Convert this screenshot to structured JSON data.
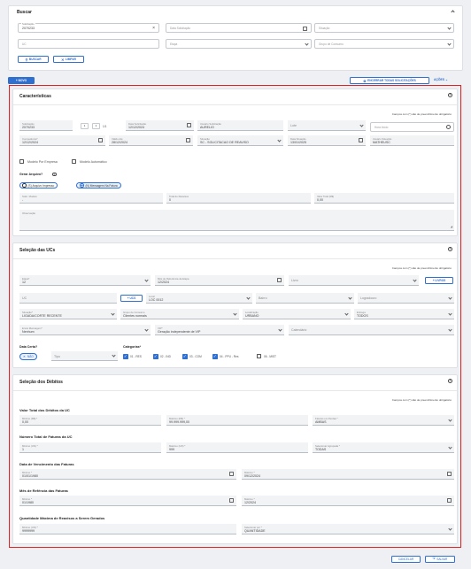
{
  "search": {
    "title": "Buscar",
    "solicitacao_label": "Solicitação",
    "solicitacao_value": "2070233",
    "data_solicitacao": "Data Solicitação",
    "situacao": "Situação",
    "uc": "UC",
    "etapa": "Etapa",
    "grupo_consumo": "Grupo de Consumo",
    "buscar": "BUSCAR",
    "limpar": "LIMPAR"
  },
  "toolbar": {
    "novo": "+ NOVO",
    "encerrar": "ENCERRAR TODAS SOLICITAÇÕES",
    "acoes": "AÇÕES"
  },
  "caracteristicas": {
    "title": "Características",
    "required_note": "Campos com (*) são de preenchimento obrigatório",
    "solicitacao_label": "Solicitação",
    "solicitacao_value": "2070233",
    "page_a": "1",
    "page_b": "1",
    "page_total": "1/1",
    "data_sol_label": "Data Solicitação",
    "data_sol_value": "12/12/2024",
    "usuario_sol_label": "Usuário Solicitação",
    "usuario_sol_value": "AURELIO",
    "lote": "Lote",
    "hora_inicio": "Hora Início",
    "competencia_label": "Competência*",
    "competencia_value": "12/12/2024",
    "valido_ate_label": "Válido Até",
    "valido_ate_value": "28/12/2024",
    "situacao_label": "Situação",
    "situacao_value": "SC - SOLICITACAO DE REAVISO",
    "data_situacao_label": "Data Situação",
    "data_situacao_value": "13/01/2025",
    "usuario_situacao_label": "Usuário Situação",
    "usuario_situacao_value": "MATHEUSC",
    "modelo_empresa": "Modelo Por Empresa",
    "modelo_automatico": "Modelo Automático",
    "gerar_arquivo": "Gerar Arquivo?",
    "radio_s": "(S) Arquivo Impresso",
    "radio_n": "(N) Mensagem Na Fatura",
    "solic_modelo_label": "Solic. Modelo",
    "solic_modelo_value": "-",
    "total_reavisos_label": "Total de Reavisos",
    "total_reavisos_value": "0",
    "valor_total_label": "Valor Total (R$)",
    "valor_total_value": "0,00",
    "observacao_label": "Observação"
  },
  "ucs": {
    "title": "Seleção das UCs",
    "required_note": "Campos com (*) são de preenchimento obrigatório",
    "etapa_label": "Etapa*",
    "etapa_value": "12",
    "mes_ref_label": "Mês de Referência da Etapa",
    "mes_ref_value": "12/2024",
    "livro": "Livro",
    "livros_btn": "+ LIVROS",
    "uc": "UC",
    "ucs_btn": "+ UCS",
    "local_label": "Local",
    "local_value": "LOC 0012",
    "bairro": "Bairro",
    "logradouro": "Logradouro",
    "situacao_label": "Situação*",
    "situacao_value": "LIGADA/CORTE RECENTE",
    "grupo_label": "Grupo de Consumo",
    "grupo_value": "Clientes normais",
    "localizacao_label": "Localização",
    "localizacao_value": "URBANO",
    "entrega_label": "Entrega",
    "entrega_value": "TODOS",
    "envio_label": "Envio Mensagem*",
    "envio_value": "Nenhum",
    "vip_label": "VIP*",
    "vip_value": "Geração independente de VIP",
    "calendario": "Calendário",
    "data_certa": "Data Certa?",
    "nao_chip": "NÃO",
    "tipo": "Tipo",
    "categorias": "Categorias*",
    "cat_items": [
      "01 - RES",
      "02 - IND",
      "03 - COM",
      "04 - PPU - Res",
      "06 - MIST"
    ]
  },
  "debitos": {
    "title": "Seleção dos Débitos",
    "required_note": "Campos com (*) são de preenchimento obrigatório",
    "valor_total_title": "Valor Total dos Débitos da UC",
    "min_rs_label": "Mínimo (R$) *",
    "min_rs_value": "0,00",
    "max_rs_label": "Máximo (R$) *",
    "max_rs_value": "99.999.999,00",
    "faturas_perdas_label": "Faturas em Perdas *",
    "faturas_perdas_value": "AMBAS",
    "num_faturas_title": "Número Total de Faturas da UC",
    "min_un_label": "Mínimo (UN) *",
    "min_un_value": "1",
    "max_un_label": "Máximo (UN) *",
    "max_un_value": "999",
    "selecionar_agrup_label": "Selecionar Agrupada *",
    "selecionar_agrup_value": "TODAS",
    "venc_title": "Data de Vencimento das Faturas",
    "venc_min_label": "Mínimo *",
    "venc_min_value": "01/01/1980",
    "venc_max_label": "Máximo *",
    "venc_max_value": "09/12/2024",
    "mes_title": "Mês de Refência das Faturas",
    "mes_min_label": "Mínimo *",
    "mes_min_value": "01/1980",
    "mes_max_label": "Máximo *",
    "mes_max_value": "12/2024",
    "qtd_title": "Quantidade Máxima de Reavisos a Serem Gerados",
    "qtd_min_label": "Mínimo (UN) *",
    "qtd_min_value": "9999999",
    "selecionar_por_label": "Selecionar por *",
    "selecionar_por_value": "QUANTIDADE"
  },
  "footer": {
    "cancelar": "CANCELAR",
    "salvar": "SALVAR"
  },
  "colors": {
    "accent": "#2f6fd0",
    "highlight": "#e02020"
  }
}
